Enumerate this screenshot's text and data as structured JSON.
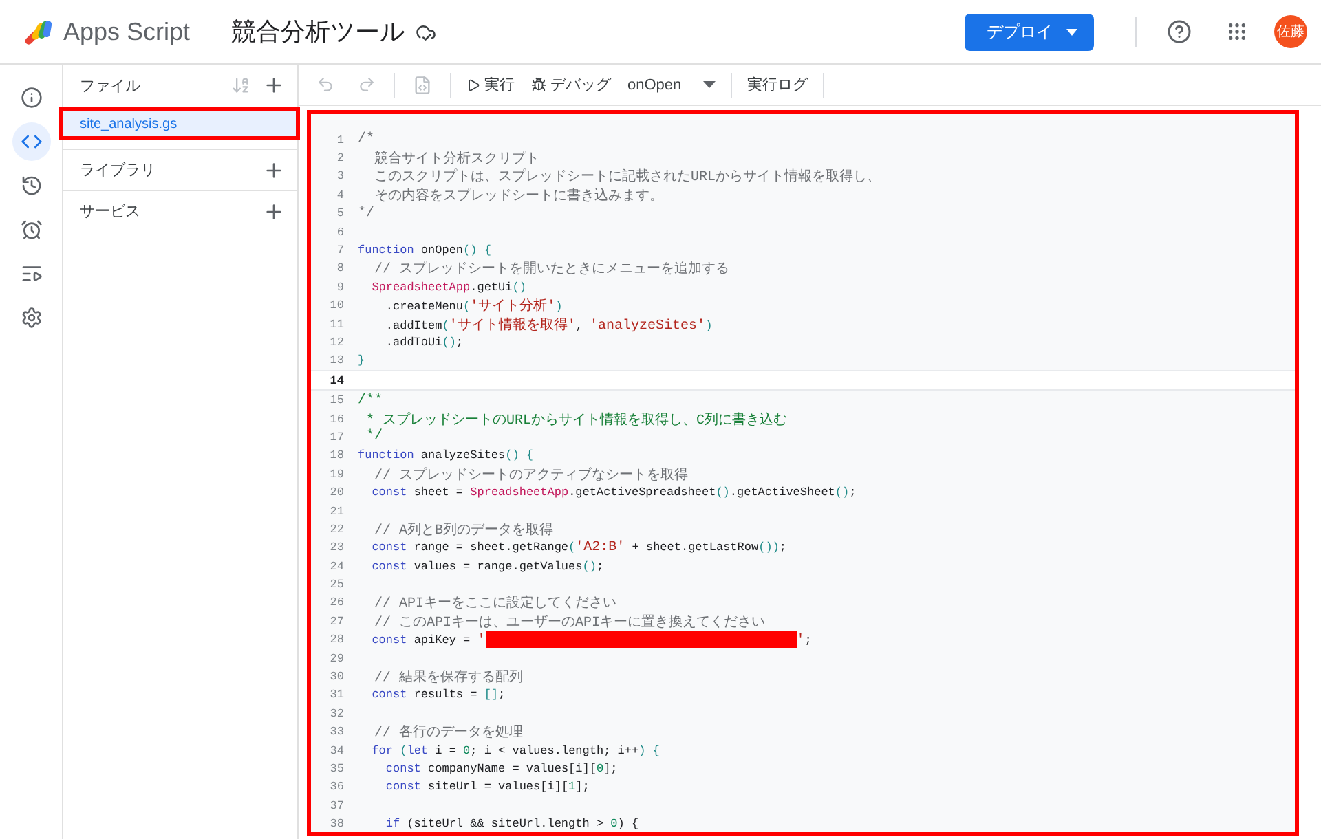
{
  "header": {
    "product": "Apps Script",
    "project_title": "競合分析ツール",
    "deploy_button": "デプロイ",
    "avatar": "佐藤"
  },
  "rail": [
    {
      "kind": "info",
      "selected": false
    },
    {
      "kind": "code",
      "selected": true
    },
    {
      "kind": "history",
      "selected": false
    },
    {
      "kind": "triggers",
      "selected": false
    },
    {
      "kind": "executions",
      "selected": false
    },
    {
      "kind": "settings",
      "selected": false
    }
  ],
  "files_panel": {
    "title": "ファイル",
    "files": [
      {
        "name": "site_analysis.gs",
        "selected": true,
        "annotated": true
      }
    ],
    "sections": [
      "ライブラリ",
      "サービス"
    ]
  },
  "toolbar": {
    "save_disabled": true,
    "run": "実行",
    "debug": "デバッグ",
    "function_select": "onOpen",
    "log": "実行ログ"
  },
  "editor": {
    "annotated": true,
    "lines": [
      {
        "n": "1",
        "tokens": [
          {
            "kind": "comment",
            "text": "/*"
          }
        ]
      },
      {
        "n": "2",
        "tokens": [
          {
            "kind": "comment",
            "text": "  競合サイト分析スクリプト"
          }
        ]
      },
      {
        "n": "3",
        "tokens": [
          {
            "kind": "comment",
            "text": "  このスクリプトは、スプレッドシートに記載されたURLからサイト情報を取得し、"
          }
        ]
      },
      {
        "n": "4",
        "tokens": [
          {
            "kind": "comment",
            "text": "  その内容をスプレッドシートに書き込みます。"
          }
        ]
      },
      {
        "n": "5",
        "tokens": [
          {
            "kind": "comment",
            "text": "*/"
          }
        ]
      },
      {
        "n": "6"
      },
      {
        "n": "7",
        "tokens": [
          {
            "kind": "keyword",
            "text": "function"
          },
          {
            "kind": "plain",
            "text": " onOpen"
          },
          {
            "kind": "bracket",
            "text": "() {"
          }
        ]
      },
      {
        "n": "8",
        "tokens": [
          {
            "kind": "comment",
            "text": "  // スプレッドシートを開いたときにメニューを追加する"
          }
        ]
      },
      {
        "n": "9",
        "tokens": [
          {
            "kind": "class",
            "text": "  SpreadsheetApp"
          },
          {
            "kind": "plain",
            "text": ".getUi"
          },
          {
            "kind": "bracket",
            "text": "()"
          }
        ]
      },
      {
        "n": "10",
        "tokens": [
          {
            "kind": "plain",
            "text": "    .createMenu"
          },
          {
            "kind": "bracket",
            "text": "("
          },
          {
            "kind": "string",
            "text": "'サイト分析'"
          },
          {
            "kind": "bracket",
            "text": ")"
          }
        ]
      },
      {
        "n": "11",
        "tokens": [
          {
            "kind": "plain",
            "text": "    .addItem"
          },
          {
            "kind": "bracket",
            "text": "("
          },
          {
            "kind": "string",
            "text": "'サイト情報を取得'"
          },
          {
            "kind": "plain",
            "text": ", "
          },
          {
            "kind": "string",
            "text": "'analyzeSites'"
          },
          {
            "kind": "bracket",
            "text": ")"
          }
        ]
      },
      {
        "n": "12",
        "tokens": [
          {
            "kind": "plain",
            "text": "    .addToUi"
          },
          {
            "kind": "bracket",
            "text": "()"
          },
          {
            "kind": "plain",
            "text": ";"
          }
        ]
      },
      {
        "n": "13",
        "tokens": [
          {
            "kind": "bracket",
            "text": "}"
          }
        ]
      },
      {
        "n": "14",
        "current": true
      },
      {
        "n": "15",
        "tokens": [
          {
            "kind": "doc",
            "text": "/**"
          }
        ]
      },
      {
        "n": "16",
        "tokens": [
          {
            "kind": "doc",
            "text": " * スプレッドシートのURLからサイト情報を取得し、C列に書き込む"
          }
        ]
      },
      {
        "n": "17",
        "tokens": [
          {
            "kind": "doc",
            "text": " */"
          }
        ]
      },
      {
        "n": "18",
        "tokens": [
          {
            "kind": "keyword",
            "text": "function"
          },
          {
            "kind": "plain",
            "text": " analyzeSites"
          },
          {
            "kind": "bracket",
            "text": "() {"
          }
        ]
      },
      {
        "n": "19",
        "tokens": [
          {
            "kind": "comment",
            "text": "  // スプレッドシートのアクティブなシートを取得"
          }
        ]
      },
      {
        "n": "20",
        "tokens": [
          {
            "kind": "keyword",
            "text": "  const"
          },
          {
            "kind": "plain",
            "text": " sheet = "
          },
          {
            "kind": "class",
            "text": "SpreadsheetApp"
          },
          {
            "kind": "plain",
            "text": ".getActiveSpreadsheet"
          },
          {
            "kind": "bracket",
            "text": "()"
          },
          {
            "kind": "plain",
            "text": ".getActiveSheet"
          },
          {
            "kind": "bracket",
            "text": "()"
          },
          {
            "kind": "plain",
            "text": ";"
          }
        ]
      },
      {
        "n": "21"
      },
      {
        "n": "22",
        "tokens": [
          {
            "kind": "comment",
            "text": "  // A列とB列のデータを取得"
          }
        ]
      },
      {
        "n": "23",
        "tokens": [
          {
            "kind": "keyword",
            "text": "  const"
          },
          {
            "kind": "plain",
            "text": " range = sheet.getRange"
          },
          {
            "kind": "bracket",
            "text": "("
          },
          {
            "kind": "string",
            "text": "'A2:B'"
          },
          {
            "kind": "plain",
            "text": " + sheet.getLastRow"
          },
          {
            "kind": "bracket",
            "text": "())"
          },
          {
            "kind": "plain",
            "text": ";"
          }
        ]
      },
      {
        "n": "24",
        "tokens": [
          {
            "kind": "keyword",
            "text": "  const"
          },
          {
            "kind": "plain",
            "text": " values = range.getValues"
          },
          {
            "kind": "bracket",
            "text": "()"
          },
          {
            "kind": "plain",
            "text": ";"
          }
        ]
      },
      {
        "n": "25"
      },
      {
        "n": "26",
        "tokens": [
          {
            "kind": "comment",
            "text": "  // APIキーをここに設定してください"
          }
        ]
      },
      {
        "n": "27",
        "tokens": [
          {
            "kind": "comment",
            "text": "  // このAPIキーは、ユーザーのAPIキーに置き換えてください"
          }
        ]
      },
      {
        "n": "28",
        "tokens": [
          {
            "kind": "keyword",
            "text": "  const"
          },
          {
            "kind": "plain",
            "text": " apiKey = "
          },
          {
            "kind": "string",
            "text": "'"
          },
          {
            "kind": "redacted"
          },
          {
            "kind": "string",
            "text": "'"
          },
          {
            "kind": "plain",
            "text": ";"
          }
        ]
      },
      {
        "n": "29"
      },
      {
        "n": "30",
        "tokens": [
          {
            "kind": "comment",
            "text": "  // 結果を保存する配列"
          }
        ]
      },
      {
        "n": "31",
        "tokens": [
          {
            "kind": "keyword",
            "text": "  const"
          },
          {
            "kind": "plain",
            "text": " results = "
          },
          {
            "kind": "bracket",
            "text": "[]"
          },
          {
            "kind": "plain",
            "text": ";"
          }
        ]
      },
      {
        "n": "32"
      },
      {
        "n": "33",
        "tokens": [
          {
            "kind": "comment",
            "text": "  // 各行のデータを処理"
          }
        ]
      },
      {
        "n": "34",
        "tokens": [
          {
            "kind": "keyword",
            "text": "  for"
          },
          {
            "kind": "bracket",
            "text": " ("
          },
          {
            "kind": "keyword",
            "text": "let"
          },
          {
            "kind": "plain",
            "text": " i = "
          },
          {
            "kind": "number",
            "text": "0"
          },
          {
            "kind": "plain",
            "text": "; i < values.length; i++"
          },
          {
            "kind": "bracket",
            "text": ") {"
          }
        ]
      },
      {
        "n": "35",
        "tokens": [
          {
            "kind": "keyword",
            "text": "    const"
          },
          {
            "kind": "plain",
            "text": " companyName = values[i]["
          },
          {
            "kind": "number",
            "text": "0"
          },
          {
            "kind": "plain",
            "text": "];"
          }
        ]
      },
      {
        "n": "36",
        "tokens": [
          {
            "kind": "keyword",
            "text": "    const"
          },
          {
            "kind": "plain",
            "text": " siteUrl = values[i]["
          },
          {
            "kind": "number",
            "text": "1"
          },
          {
            "kind": "plain",
            "text": "];"
          }
        ]
      },
      {
        "n": "37"
      },
      {
        "n": "38",
        "tokens": [
          {
            "kind": "keyword",
            "text": "    if"
          },
          {
            "kind": "plain",
            "text": " (siteUrl && siteUrl.length > "
          },
          {
            "kind": "number",
            "text": "0"
          },
          {
            "kind": "plain",
            "text": ") {"
          }
        ]
      }
    ]
  }
}
